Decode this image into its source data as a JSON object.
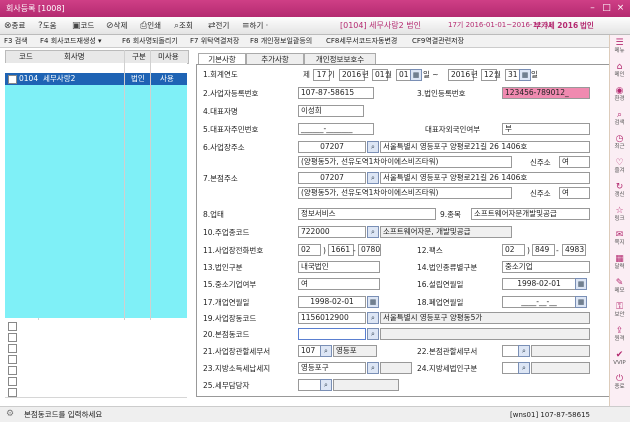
{
  "window": {
    "title": "회사등록 [1008]",
    "min": "–",
    "max": "□",
    "close": "×"
  },
  "toolbar": {
    "buttons": [
      {
        "icon": "⊗",
        "label": "종료"
      },
      {
        "icon": "?",
        "label": "도움"
      },
      {
        "icon": "▣",
        "label": "코드"
      },
      {
        "icon": "⊘",
        "label": "삭제"
      },
      {
        "icon": "⎙",
        "label": "인쇄"
      },
      {
        "icon": "⌕",
        "label": "조회"
      },
      {
        "icon": "⇄",
        "label": "전기"
      },
      {
        "icon": "≡",
        "label": "하기 ·"
      }
    ],
    "info_company": "[0104] 세무사랑2 법인",
    "info_period": "17기 2016-01-01~2016-12-31",
    "info_vat": "부가세 2016",
    "info_tax": "법인"
  },
  "fkeys": [
    "F3 검색",
    "F4 회사코드재생성 ▾",
    "F6 회사명되돌리기",
    "F7 위탁역결저장",
    "F8 개인정보일괄등의",
    "CF8세무서코드자동변경",
    "CF9역결관련저장"
  ],
  "list": {
    "headers": [
      "코드",
      "회사명",
      "구분",
      "미사용"
    ],
    "rows": [
      {
        "code": "0104",
        "name": "세무사랑2",
        "type": "법인",
        "use": "사용"
      }
    ]
  },
  "tabs": [
    "기본사항",
    "추가사항",
    "개인정보보호수"
  ],
  "form": {
    "f1": {
      "label": "1.회계연도",
      "prefix": "제",
      "term": "17",
      "term_suffix": "기",
      "from_y": "2016",
      "y1": "년",
      "from_m": "01",
      "m1": "월",
      "from_d": "01",
      "d1": "일 ~",
      "to_y": "2016",
      "y2": "년",
      "to_m": "12",
      "m2": "월",
      "to_d": "31",
      "d2": "일"
    },
    "f2": {
      "label": "2.사업자등록번호",
      "value": "107-87-58615"
    },
    "f3": {
      "label": "3.법인등록번호",
      "value": "123456-789012_"
    },
    "f4": {
      "label": "4.대표자명",
      "value": "이성희"
    },
    "f5": {
      "label": "5.대표자주민번호",
      "value": "______-_______",
      "foreign_label": "대표자외국인여부",
      "foreign_value": "부"
    },
    "f6": {
      "label": "6.사업장주소",
      "zip": "07207",
      "addr1": "서울특별시 영등포구 양평로21길 26 1406호",
      "addr2": "(양평동5가, 선유도역1차아이에스비즈타워)",
      "new_label": "신주소",
      "new_value": "여"
    },
    "f7": {
      "label": "7.본점주소",
      "zip": "07207",
      "addr1": "서울특별시 영등포구 양평로21길 26 1406호",
      "addr2": "(양평동5가, 선유도역1차아이에스비즈타워)",
      "new_label": "신주소",
      "new_value": "여"
    },
    "f8": {
      "label": "8.업태",
      "value": "정보서비스"
    },
    "f9": {
      "label": "9.종목",
      "value": "소프트웨어자문개발및공급"
    },
    "f10": {
      "label": "10.주업종코드",
      "code": "722000",
      "desc": "소프트웨어자문, 개발및공급"
    },
    "f11": {
      "label": "11.사업장전화번호",
      "a": "02",
      "b": "1661",
      "c": "0780",
      "sep1": ")",
      "sep2": "-"
    },
    "f12": {
      "label": "12.팩스",
      "a": "02",
      "b": "849",
      "c": "4983",
      "sep1": ")",
      "sep2": "-"
    },
    "f13": {
      "label": "13.법인구분",
      "value": "내국법인"
    },
    "f14": {
      "label": "14.법인종류별구분",
      "value": "중소기업"
    },
    "f15": {
      "label": "15.중소기업여부",
      "value": "여"
    },
    "f16": {
      "label": "16.설립연월일",
      "value": "1998-02-01"
    },
    "f17": {
      "label": "17.개업연월일",
      "value": "1998-02-01"
    },
    "f18": {
      "label": "18.폐업연월일",
      "value": "____-__-__"
    },
    "f19": {
      "label": "19.사업장동코드",
      "code": "1156012900",
      "desc": "서울특별시 영등포구 양평동5가"
    },
    "f20": {
      "label": "20.본점동코드",
      "code": ""
    },
    "f21": {
      "label": "21.사업장관할세무서",
      "code": "107",
      "name": "영등포"
    },
    "f22": {
      "label": "22.본점관할세무서",
      "code": ""
    },
    "f23": {
      "label": "23.지방소득세납세지",
      "code": "영등포구"
    },
    "f24": {
      "label": "24.지방세법인구분",
      "code": ""
    },
    "f25": {
      "label": "25.세무담당자",
      "code": ""
    }
  },
  "sidebar": [
    {
      "icon": "☰",
      "label": "메뉴"
    },
    {
      "icon": "⌂",
      "label": "메인"
    },
    {
      "icon": "◉",
      "label": "환경"
    },
    {
      "icon": "⌕",
      "label": "검색"
    },
    {
      "icon": "◷",
      "label": "최근"
    },
    {
      "icon": "♡",
      "label": "즐겨"
    },
    {
      "icon": "↻",
      "label": "갱신"
    },
    {
      "icon": "☆",
      "label": "링크"
    },
    {
      "icon": "✉",
      "label": "쪽지"
    },
    {
      "icon": "▦",
      "label": "달력"
    },
    {
      "icon": "✎",
      "label": "메모"
    },
    {
      "icon": "⚿",
      "label": "보안"
    },
    {
      "icon": "⇪",
      "label": "원격"
    },
    {
      "icon": "✔",
      "label": "VVIP"
    },
    {
      "icon": "⏻",
      "label": "종료"
    }
  ],
  "status": {
    "message": "본점동코드를 입력하세요",
    "right": "[wns01]  107-87-58615"
  }
}
